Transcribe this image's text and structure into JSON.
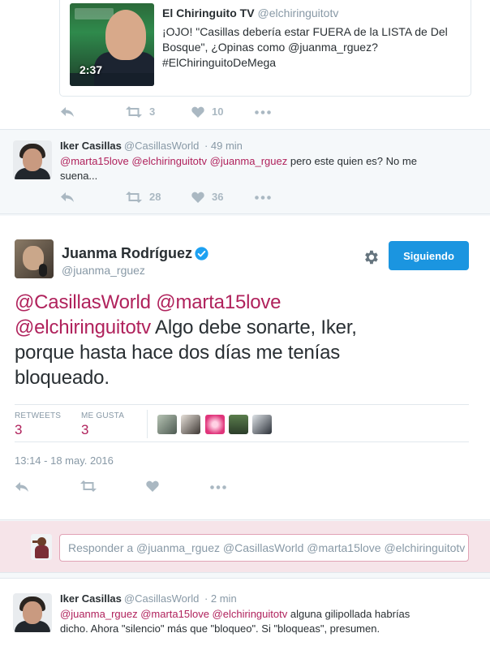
{
  "quoted_tweet": {
    "video_duration": "2:37",
    "author_name": "El Chiringuito TV",
    "author_handle": "@elchiringuitotv",
    "text_line1": "¡OJO! \"Casillas debería estar FUERA de la LISTA de Del",
    "text_line2": "Bosque\", ¿Opinas como @juanma_rguez?",
    "text_line3": "#ElChiringuitoDeMega"
  },
  "top_actions": {
    "retweets": "3",
    "likes": "10"
  },
  "reply1": {
    "author_name": "Iker Casillas",
    "author_handle": "@CasillasWorld",
    "time": "· 49 min",
    "mentions": "@marta15love @elchiringuitotv @juanma_rguez",
    "text_after_mentions": " pero este quien es? No me",
    "text_line2": "suena...",
    "retweets": "28",
    "likes": "36"
  },
  "main_tweet": {
    "author_name": "Juanma Rodríguez",
    "author_handle": "@juanma_rguez",
    "follow_button": "Siguiendo",
    "mention1": "@CasillasWorld",
    "mention2": "@marta15love",
    "mention3": "@elchiringuitotv",
    "text_part1": " Algo debe sonarte, Iker,",
    "text_line3": "porque hasta hace dos días me tenías",
    "text_line4": "bloqueado.",
    "retweets_label": "RETWEETS",
    "retweets_count": "3",
    "likes_label": "ME GUSTA",
    "likes_count": "3",
    "timestamp": "13:14 - 18 may. 2016"
  },
  "compose": {
    "placeholder": "Responder a @juanma_rguez @CasillasWorld @marta15love @elchiringuitotv"
  },
  "reply2": {
    "author_name": "Iker Casillas",
    "author_handle": "@CasillasWorld",
    "time": "· 2 min",
    "mentions": "@juanma_rguez @marta15love @elchiringuitotv",
    "text_after_mentions": " alguna gilipollada habrías",
    "text_line2": "dicho. Ahora \"silencio\" más que \"bloqueo\". Si \"bloqueas\", presumen."
  },
  "colors": {
    "link_accent": "#b0225c",
    "follow_button": "#1b95e0",
    "icon_gray": "#aab8c2",
    "compose_bg": "#f6e4e9"
  }
}
